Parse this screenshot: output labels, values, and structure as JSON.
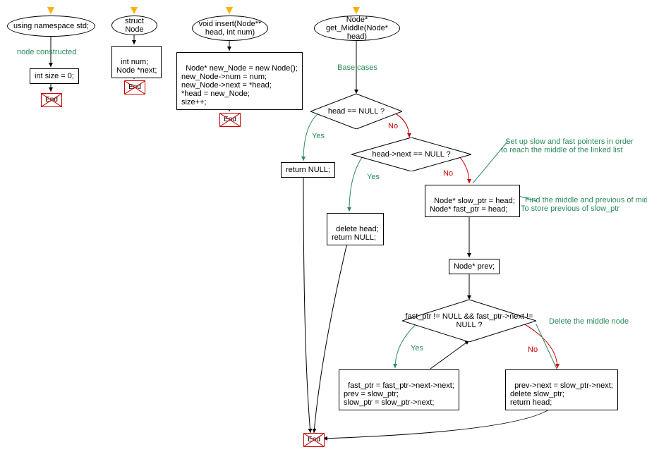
{
  "col1": {
    "ellipse": "using namespace std;",
    "comment": "node constructed",
    "rect": "int size = 0;",
    "end": "End"
  },
  "col2": {
    "ellipse": "struct Node",
    "rect": "int num;\nNode *next;",
    "end": "End"
  },
  "col3": {
    "ellipse": "void insert(Node** head, int num)",
    "rect": "Node* new_Node = new Node();\nnew_Node->num = num;\nnew_Node->next = *head;\n*head = new_Node;\nsize++;",
    "end": "End"
  },
  "col4": {
    "ellipse": "Node* get_Middle(Node* head)",
    "comment_base": "Base cases",
    "d1": "head == NULL ?",
    "d2": "head->next == NULL ?",
    "return_null": "return NULL;",
    "delete_head": "delete head;\nreturn NULL;",
    "ptr_init": "Node* slow_ptr = head;\nNode* fast_ptr = head;",
    "prev_decl": "Node* prev;",
    "d3": "fast_ptr != NULL && fast_ptr->next != NULL ?",
    "loop_body": "fast_ptr = fast_ptr->next->next;\nprev = slow_ptr;\nslow_ptr = slow_ptr->next;",
    "after_loop": "prev->next = slow_ptr->next;\ndelete slow_ptr;\nreturn head;",
    "comment_setup": "Set up slow and fast pointers in order\nto reach the middle of the linked list",
    "comment_find": "Find the middle and previous of middle.\nTo store previous of slow_ptr",
    "comment_delete": "Delete the middle node",
    "yes": "Yes",
    "no": "No",
    "end": "End"
  }
}
